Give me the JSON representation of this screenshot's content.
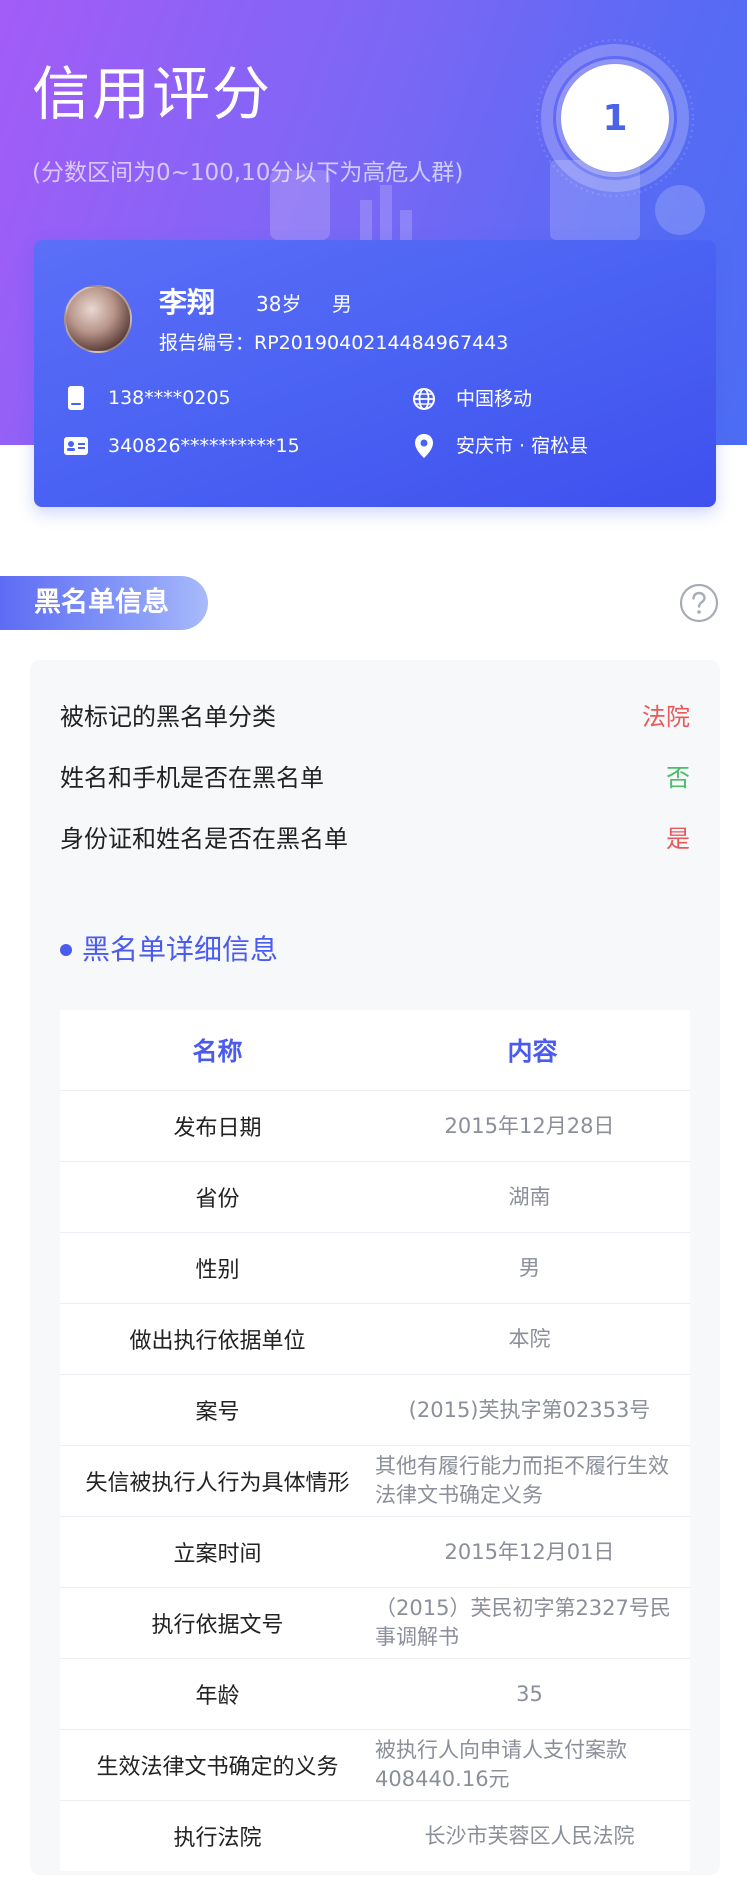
{
  "header": {
    "title": "信用评分",
    "subtitle": "(分数区间为0~100,10分以下为高危人群)",
    "score": "1"
  },
  "profile": {
    "name": "李翔",
    "age": "38岁",
    "gender": "男",
    "report_no": "报告编号：RP2019040214484967443",
    "phone": "138****0205",
    "carrier": "中国移动",
    "id_number": "340826**********15",
    "location": "安庆市 · 宿松县"
  },
  "section": {
    "title": "黑名单信息"
  },
  "blacklist": {
    "rows": [
      {
        "label": "被标记的黑名单分类",
        "value": "法院",
        "status": "red"
      },
      {
        "label": "姓名和手机是否在黑名单",
        "value": "否",
        "status": "green"
      },
      {
        "label": "身份证和姓名是否在黑名单",
        "value": "是",
        "status": "red"
      }
    ],
    "detail_title": "黑名单详细信息",
    "table": {
      "headers": [
        "名称",
        "内容"
      ],
      "rows": [
        {
          "k": "发布日期",
          "v": "2015年12月28日"
        },
        {
          "k": "省份",
          "v": "湖南"
        },
        {
          "k": "性别",
          "v": "男"
        },
        {
          "k": "做出执行依据单位",
          "v": "本院"
        },
        {
          "k": "案号",
          "v": "(2015)芙执字第02353号"
        },
        {
          "k": "失信被执行人行为具体情形",
          "v": "其他有履行能力而拒不履行生效法律文书确定义务"
        },
        {
          "k": "立案时间",
          "v": "2015年12月01日"
        },
        {
          "k": "执行依据文号",
          "v": "（2015）芙民初字第2327号民事调解书"
        },
        {
          "k": "年龄",
          "v": "35"
        },
        {
          "k": "生效法律文书确定的义务",
          "v": "被执行人向申请人支付案款408440.16元"
        },
        {
          "k": "执行法院",
          "v": "长沙市芙蓉区人民法院"
        }
      ]
    }
  },
  "colors": {
    "accent": "#4a5bee",
    "red": "#e85a5a",
    "green": "#4cbb6a"
  },
  "icons": {
    "phone": "phone-icon",
    "carrier": "globe-icon",
    "id": "id-card-icon",
    "location": "location-pin-icon",
    "help": "help-icon"
  }
}
